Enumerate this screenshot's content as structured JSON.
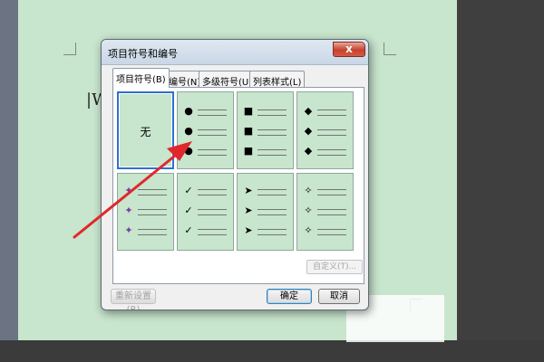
{
  "document": {
    "text": "|W"
  },
  "dialog": {
    "title": "项目符号和编号",
    "close_symbol": "x",
    "tabs": [
      {
        "label": "项目符号(B)",
        "active": true
      },
      {
        "label": "编号(N)",
        "active": false
      },
      {
        "label": "多级符号(U)",
        "active": false
      },
      {
        "label": "列表样式(L)",
        "active": false
      }
    ],
    "bullet_options": [
      {
        "label": "无",
        "selected": true,
        "icon": "none"
      },
      {
        "symbol": "●",
        "icon": "filled-circle"
      },
      {
        "symbol": "■",
        "icon": "filled-square"
      },
      {
        "symbol": "◆",
        "icon": "filled-diamond"
      },
      {
        "symbol": "✦",
        "icon": "colorful-star-bullet"
      },
      {
        "symbol": "✓",
        "icon": "checkmark"
      },
      {
        "symbol": "➤",
        "icon": "arrowhead"
      },
      {
        "symbol": "✧",
        "icon": "outline-star"
      }
    ],
    "custom_button": "自定义(T)...",
    "reset_button": "重新设置(R)",
    "ok_button": "确定",
    "cancel_button": "取消"
  },
  "colors": {
    "page_background": "#c8e5cd",
    "selection_border": "#2e6fd3",
    "annotation_arrow": "#e0282c"
  }
}
